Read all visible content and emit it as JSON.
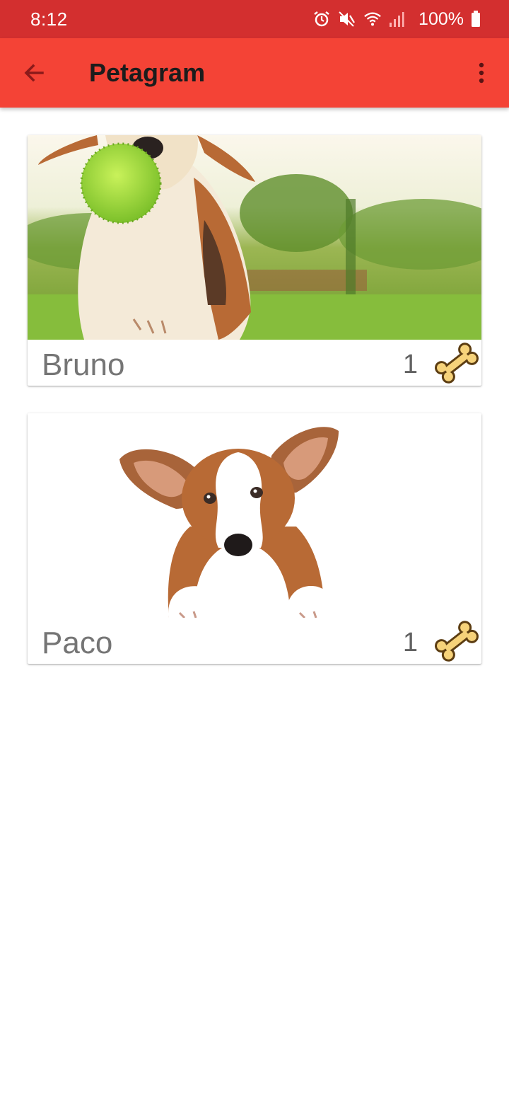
{
  "status_bar": {
    "time": "8:12",
    "battery": "100%",
    "icons": [
      "alarm-icon",
      "mute-icon",
      "wifi-icon",
      "signal-icon",
      "battery-icon"
    ]
  },
  "app_bar": {
    "title": "Petagram",
    "back_icon": "arrow-back-icon",
    "menu_icon": "more-vert-icon",
    "color": "#f44336",
    "status_color": "#d32f2f"
  },
  "pets": [
    {
      "name": "Bruno",
      "likes": "1",
      "photo": "beagle running with green ball"
    },
    {
      "name": "Paco",
      "likes": "1",
      "photo": "corgi puppy lying down"
    }
  ],
  "like_icon": "bone-icon"
}
